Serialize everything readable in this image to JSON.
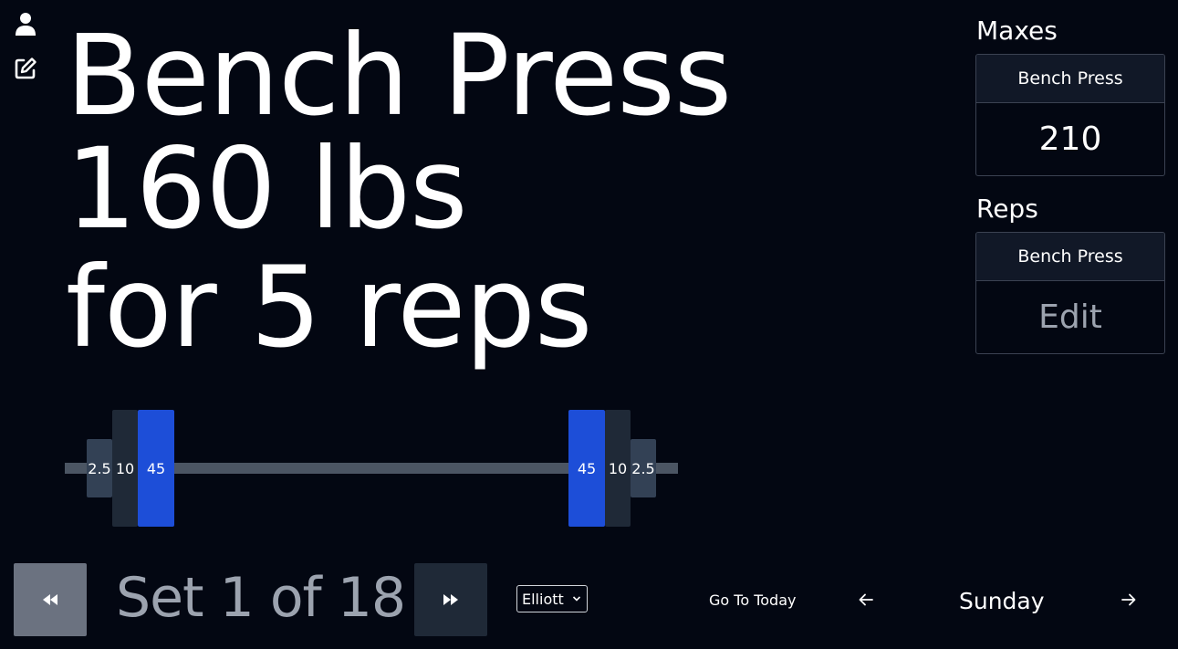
{
  "icons": {
    "user": "user-icon",
    "edit": "edit-icon",
    "rewind": "rewind-icon",
    "fast_forward": "fast-forward-icon",
    "arrow_left": "arrow-left-icon",
    "arrow_right": "arrow-right-icon",
    "chevron": "chevron-down-icon"
  },
  "headline": {
    "exercise": "Bench Press",
    "weight": "160 lbs",
    "reps": "for 5 reps"
  },
  "maxes": {
    "title": "Maxes",
    "exercise": "Bench Press",
    "value": "210"
  },
  "reps_panel": {
    "title": "Reps",
    "exercise": "Bench Press",
    "action": "Edit"
  },
  "barbell": {
    "left_plates": [
      "2.5",
      "10",
      "45"
    ],
    "right_plates": [
      "45",
      "10",
      "2.5"
    ]
  },
  "set_nav": {
    "label": "Set 1 of 18"
  },
  "user_select": {
    "selected": "Elliott"
  },
  "date_nav": {
    "today_label": "Go To Today",
    "day": "Sunday"
  },
  "colors": {
    "background": "#030712",
    "plate_45": "#1d4ed8",
    "plate_10": "#1f2937",
    "plate_2_5": "#334155",
    "bar": "#4b5563",
    "prev_button": "#6b7280",
    "next_button": "#1f2937"
  }
}
